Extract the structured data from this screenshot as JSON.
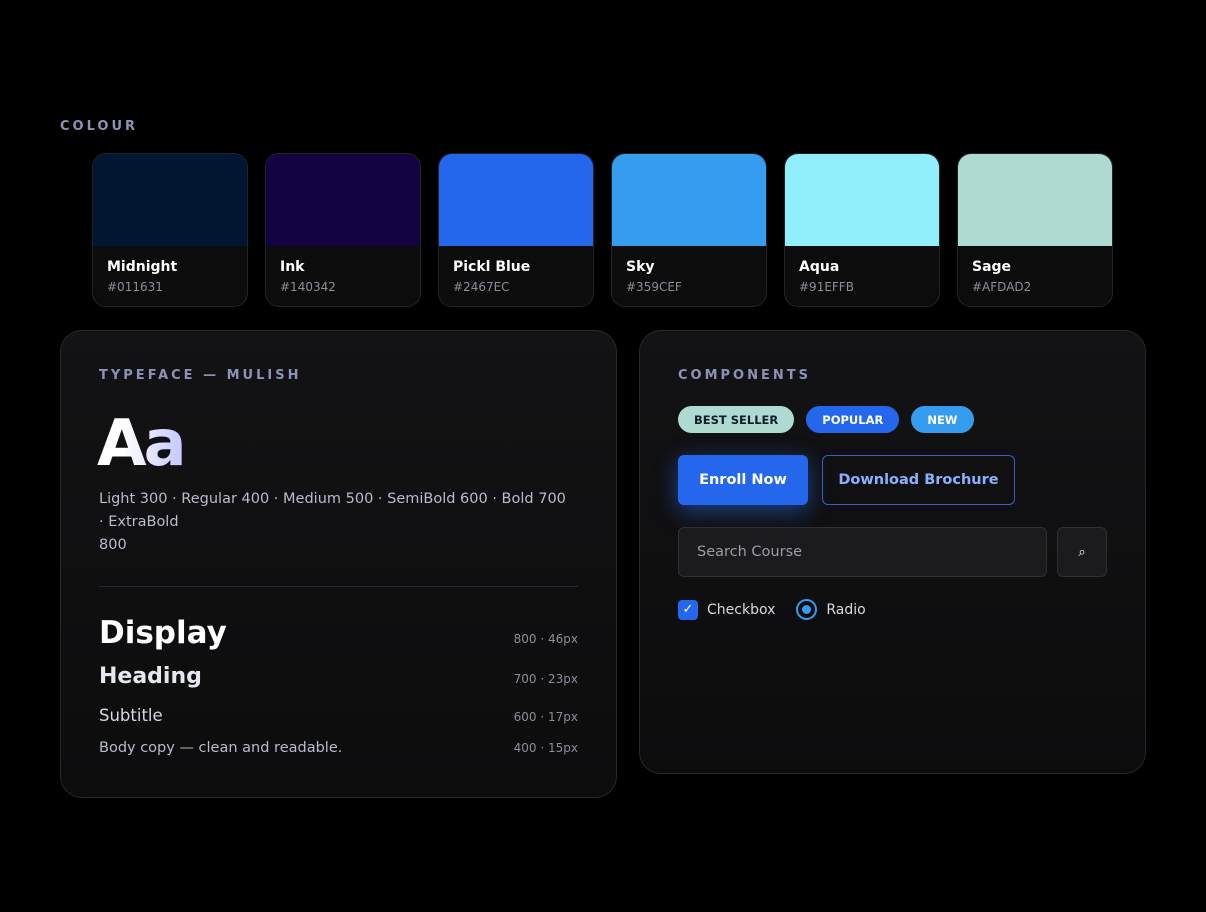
{
  "colour_section": {
    "label": "COLOUR",
    "swatches": [
      {
        "name": "Midnight",
        "hex": "#011631"
      },
      {
        "name": "Ink",
        "hex": "#140342"
      },
      {
        "name": "Pickl Blue",
        "hex": "#2467EC"
      },
      {
        "name": "Sky",
        "hex": "#359CEF"
      },
      {
        "name": "Aqua",
        "hex": "#91EFFB"
      },
      {
        "name": "Sage",
        "hex": "#AFDAD2"
      }
    ]
  },
  "typeface": {
    "label": "TYPEFACE — MULISH",
    "sample": "Aa",
    "weights": "Light 300 · Regular 400 · Medium 500 · SemiBold 600 · Bold 700 · ExtraBold",
    "weights_tail": "800",
    "scale": [
      {
        "name": "Display",
        "spec": "800 · 46px"
      },
      {
        "name": "Heading",
        "spec": "700 · 23px"
      },
      {
        "name": "Subtitle",
        "spec": "600 · 17px"
      },
      {
        "name": "Body copy — clean and readable.",
        "spec": "400 · 15px"
      }
    ]
  },
  "components": {
    "label": "COMPONENTS",
    "badges": {
      "best_seller": "BEST SELLER",
      "popular": "POPULAR",
      "new": "NEW"
    },
    "primary_button": "Enroll Now",
    "secondary_button": "Download Brochure",
    "search_placeholder": "Search Course",
    "search_icon": "magnifier-icon",
    "checkbox_label": "Checkbox",
    "checkbox_checked": true,
    "radio_label": "Radio",
    "radio_selected": true
  }
}
